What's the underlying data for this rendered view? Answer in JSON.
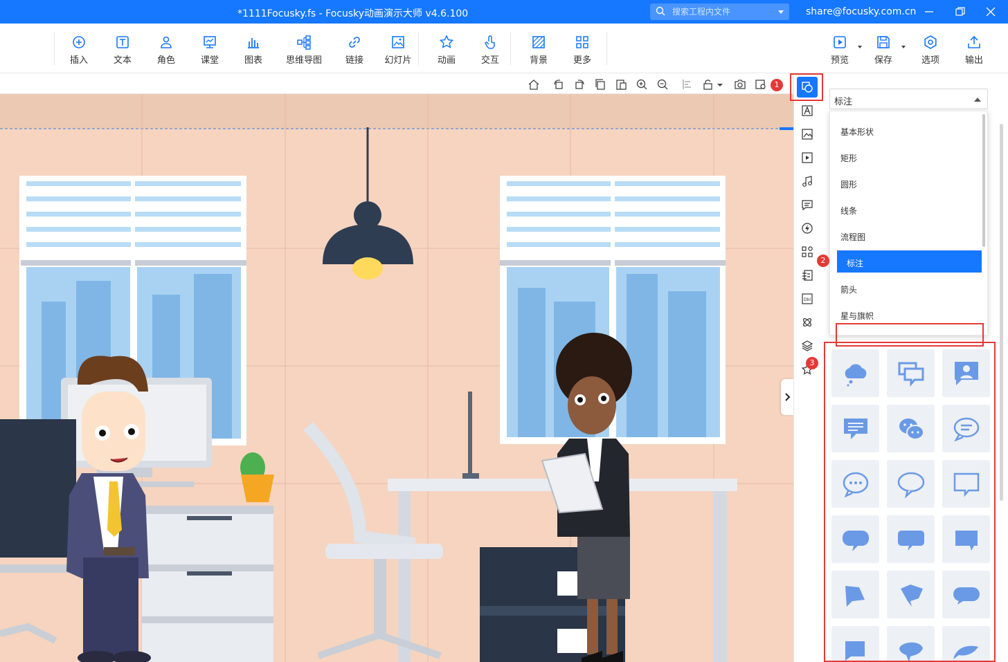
{
  "window": {
    "title": "*1111Focusky.fs - Focusky动画演示大师  v4.6.100",
    "search_placeholder": "搜索工程内文件",
    "account": "share@focusky.com.cn"
  },
  "toolbar": {
    "items": [
      {
        "label": "插入",
        "icon": "insert-icon"
      },
      {
        "label": "文本",
        "icon": "text-icon"
      },
      {
        "label": "角色",
        "icon": "character-icon"
      },
      {
        "label": "课堂",
        "icon": "classroom-icon"
      },
      {
        "label": "图表",
        "icon": "chart-icon"
      },
      {
        "label": "思维导图",
        "icon": "mindmap-icon"
      },
      {
        "label": "链接",
        "icon": "link-icon"
      },
      {
        "label": "幻灯片",
        "icon": "slide-icon"
      },
      {
        "label": "动画",
        "icon": "animation-icon"
      },
      {
        "label": "交互",
        "icon": "interaction-icon"
      },
      {
        "label": "背景",
        "icon": "background-icon"
      },
      {
        "label": "更多",
        "icon": "more-icon"
      }
    ],
    "right": [
      {
        "label": "预览",
        "icon": "preview-icon"
      },
      {
        "label": "保存",
        "icon": "save-icon"
      },
      {
        "label": "选项",
        "icon": "options-icon"
      },
      {
        "label": "输出",
        "icon": "export-icon"
      }
    ]
  },
  "panel": {
    "selected": "标注",
    "options": [
      "基本形状",
      "矩形",
      "圆形",
      "线条",
      "流程图",
      "标注",
      "箭头",
      "星与旗帜"
    ],
    "selected_index": 5
  },
  "badges": [
    "1",
    "2",
    "3"
  ],
  "colors": {
    "accent": "#1677ff",
    "highlight": "#e53935",
    "shape_fill": "#6a9ae6"
  }
}
